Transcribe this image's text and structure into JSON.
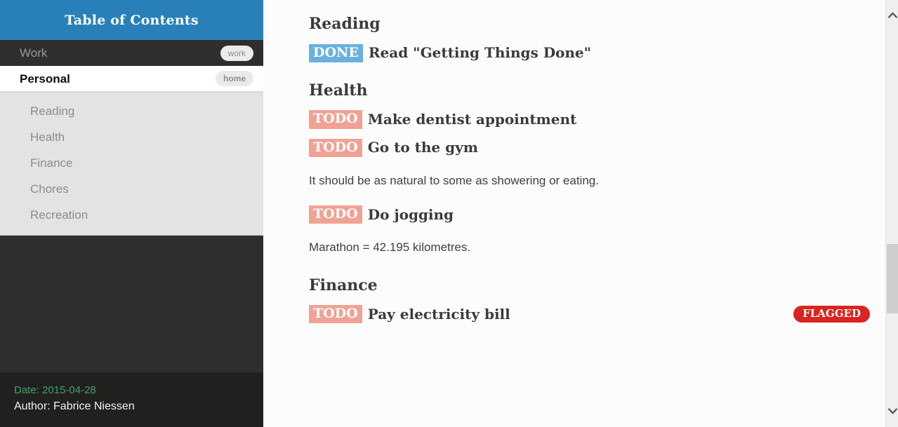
{
  "sidebar": {
    "header_title": "Table of Contents",
    "top_items": [
      {
        "label": "Work",
        "tag": "work",
        "active": false
      },
      {
        "label": "Personal",
        "tag": "home",
        "active": true
      }
    ],
    "sub_items": [
      {
        "label": "Reading"
      },
      {
        "label": "Health"
      },
      {
        "label": "Finance"
      },
      {
        "label": "Chores"
      },
      {
        "label": "Recreation"
      }
    ],
    "footer": {
      "date": "Date: 2015-04-28",
      "author": "Author: Fabrice Niessen"
    }
  },
  "content": {
    "blocks": [
      {
        "kind": "heading",
        "text": "Reading"
      },
      {
        "kind": "todo",
        "keyword": "DONE",
        "state": "done",
        "title": "Read \"Getting Things Done\"",
        "flag": ""
      },
      {
        "kind": "heading",
        "text": "Health"
      },
      {
        "kind": "todo",
        "keyword": "TODO",
        "state": "todo",
        "title": "Make dentist appointment",
        "flag": ""
      },
      {
        "kind": "todo",
        "keyword": "TODO",
        "state": "todo",
        "title": "Go to the gym",
        "flag": ""
      },
      {
        "kind": "para",
        "text": "It should be as natural to some as showering or eating."
      },
      {
        "kind": "todo",
        "keyword": "TODO",
        "state": "todo",
        "title": "Do jogging",
        "flag": ""
      },
      {
        "kind": "para",
        "text": "Marathon = 42.195 kilometres."
      },
      {
        "kind": "heading",
        "text": "Finance"
      },
      {
        "kind": "todo",
        "keyword": "TODO",
        "state": "todo",
        "title": "Pay electricity bill",
        "flag": "FLAGGED"
      }
    ]
  },
  "scrollbar": {
    "up_arrow_icon": "chevron-up-icon",
    "down_arrow_icon": "chevron-down-icon"
  },
  "colors": {
    "header_blue": "#2980b9",
    "sidebar_dark": "#302e2d",
    "sidebar_footer": "#221f1f",
    "sublist_gray": "#e3e3e3",
    "done_badge": "#6ab0de",
    "todo_badge": "#f0a295",
    "flag_red": "#d9241f",
    "date_green": "#3aa764"
  }
}
